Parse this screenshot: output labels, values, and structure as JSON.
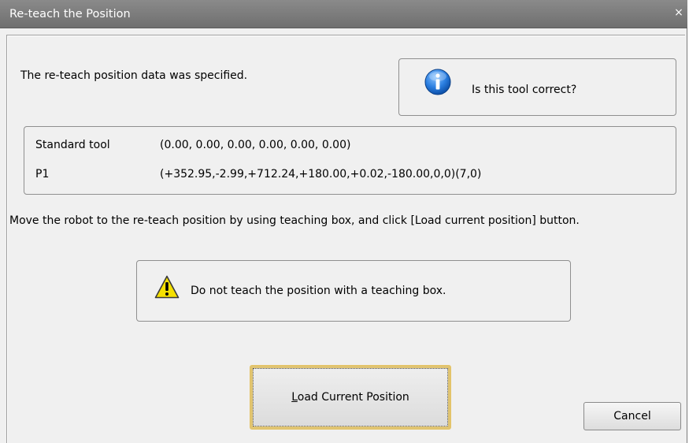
{
  "window": {
    "title": "Re-teach the Position",
    "close_glyph": "×"
  },
  "message": {
    "specified": "The re-teach position data was specified.",
    "instruction": "Move the robot to the re-teach position by using teaching box, and click [Load current position] button."
  },
  "tool_check": {
    "icon": "info-icon",
    "text": "Is this tool correct?"
  },
  "position_info": {
    "rows": [
      {
        "label": "Standard tool",
        "value": "(0.00, 0.00, 0.00, 0.00, 0.00, 0.00)"
      },
      {
        "label": "P1",
        "value": "(+352.95,-2.99,+712.24,+180.00,+0.02,-180.00,0,0)(7,0)"
      }
    ]
  },
  "warning": {
    "icon": "warning-icon",
    "text": "Do not teach the position with a teaching box."
  },
  "buttons": {
    "load_mnemonic": "L",
    "load_rest": "oad Current Position",
    "cancel": "Cancel"
  },
  "colors": {
    "titlebar": "#7d7d7d",
    "dialog_bg": "#f0f0f0",
    "info_blue": "#1f6fd0",
    "warning_yellow": "#f5e000",
    "focus_border": "#e0c472"
  }
}
